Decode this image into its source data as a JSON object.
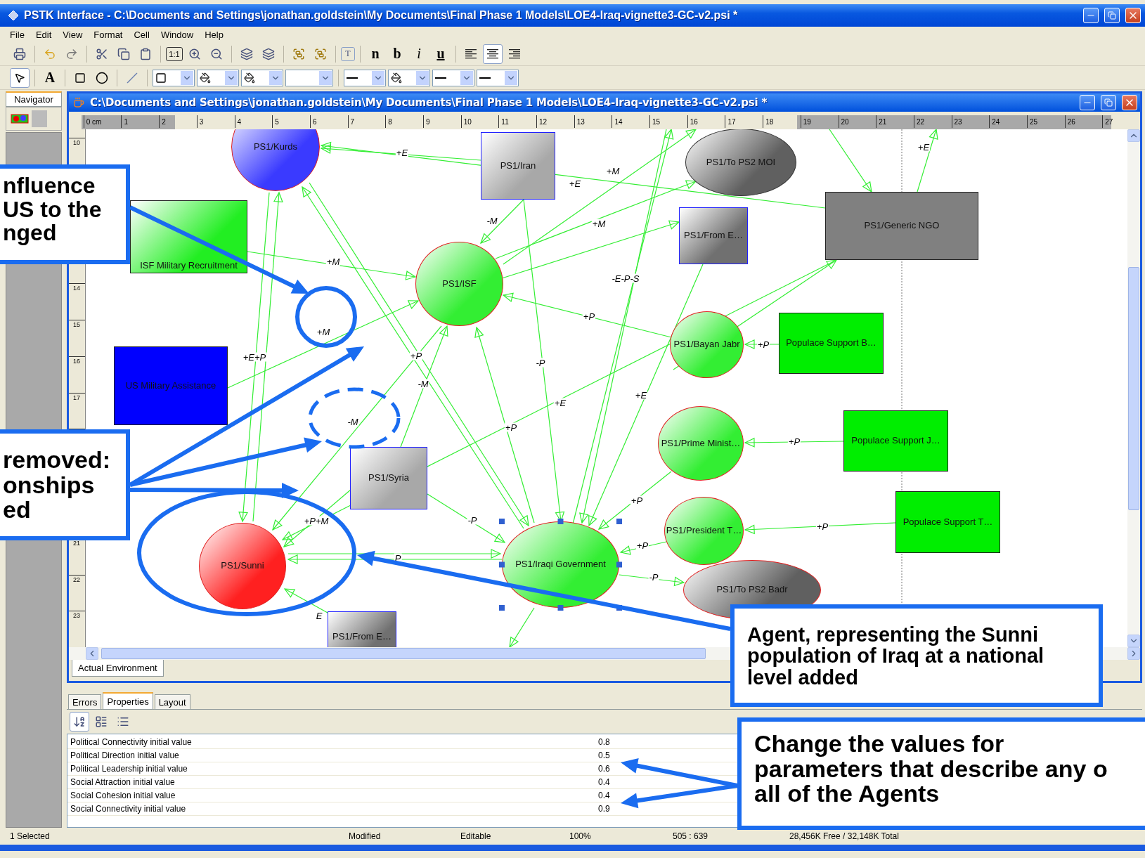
{
  "window": {
    "title": "PSTK Interface - C:\\Documents and Settings\\jonathan.goldstein\\My Documents\\Final Phase 1 Models\\LOE4-Iraq-vignette3-GC-v2.psi *"
  },
  "menu": [
    "File",
    "Edit",
    "View",
    "Format",
    "Cell",
    "Window",
    "Help"
  ],
  "toolbar": {
    "zoom_actual": "1:1",
    "text_box": "T",
    "styles": [
      {
        "label": "n",
        "kind": "normal"
      },
      {
        "label": "b",
        "kind": "bold"
      },
      {
        "label": "i",
        "kind": "italic"
      },
      {
        "label": "u",
        "kind": "underline"
      }
    ],
    "align": [
      {
        "kind": "left",
        "selected": false
      },
      {
        "kind": "center",
        "selected": true
      },
      {
        "kind": "right",
        "selected": false
      }
    ]
  },
  "drawing_tools": [
    {
      "kind": "pointer",
      "selected": true
    },
    {
      "kind": "text",
      "label": "A",
      "selected": false
    },
    {
      "kind": "rect",
      "selected": false
    },
    {
      "kind": "ellipse",
      "selected": false
    },
    {
      "kind": "line",
      "selected": false
    }
  ],
  "navigator": {
    "tab": "Navigator"
  },
  "document": {
    "title": "C:\\Documents and Settings\\jonathan.goldstein\\My Documents\\Final Phase 1 Models\\LOE4-Iraq-vignette3-GC-v2.psi *",
    "ruler_h": [
      "0 cm",
      "1",
      "2",
      "3",
      "4",
      "5",
      "6",
      "7",
      "8",
      "9",
      "10",
      "11",
      "12",
      "13",
      "14",
      "15",
      "16",
      "17",
      "18",
      "19",
      "20",
      "21",
      "22",
      "23",
      "24",
      "25",
      "26",
      "27"
    ],
    "ruler_v": [
      [
        "10"
      ],
      [
        "14",
        "15",
        "16",
        "17"
      ],
      [
        "21",
        "22",
        "23"
      ]
    ],
    "nodes": [
      {
        "label": "PS1/Kurds",
        "kind": "ellipse",
        "gradient": true,
        "color": "#3a3aff",
        "selected": false
      },
      {
        "label": "PS1/Iran",
        "kind": "rect",
        "gradient": true,
        "color": "#a8a8a8",
        "selected": false
      },
      {
        "label": "PS1/To PS2 MOI",
        "kind": "ellipse",
        "gradient": true,
        "color": "#606060",
        "selected": false
      },
      {
        "label": "ISF Military Recruitment",
        "kind": "rect",
        "gradient": true,
        "color": "#22ee22",
        "selected": false
      },
      {
        "label": "PS1/Generic NGO",
        "kind": "rect",
        "gradient": false,
        "color": "#808080",
        "selected": false
      },
      {
        "label": "PS1/From E…",
        "kind": "rect",
        "gradient": true,
        "color": "#707070",
        "selected": false
      },
      {
        "label": "PS1/ISF",
        "kind": "ellipse",
        "gradient": true,
        "color": "#33ee33",
        "selected": false
      },
      {
        "label": "PS1/Bayan Jabr",
        "kind": "ellipse",
        "gradient": true,
        "color": "#33ee33",
        "selected": false
      },
      {
        "label": "Populace Support B…",
        "kind": "rect",
        "gradient": false,
        "color": "#00ee00",
        "selected": false
      },
      {
        "label": "US Military Assistance",
        "kind": "rect",
        "gradient": false,
        "color": "#0000ff",
        "selected": false
      },
      {
        "label": "PS1/Prime Minist…",
        "kind": "ellipse",
        "gradient": true,
        "color": "#33ee33",
        "selected": false
      },
      {
        "label": "Populace Support J…",
        "kind": "rect",
        "gradient": false,
        "color": "#00ee00",
        "selected": false
      },
      {
        "label": "PS1/Syria",
        "kind": "rect",
        "gradient": true,
        "color": "#a8a8a8",
        "selected": false
      },
      {
        "label": "Populace Support T…",
        "kind": "rect",
        "gradient": false,
        "color": "#00ee00",
        "selected": false
      },
      {
        "label": "PS1/President T…",
        "kind": "ellipse",
        "gradient": true,
        "color": "#33ee33",
        "selected": false
      },
      {
        "label": "PS1/Sunni",
        "kind": "ellipse",
        "gradient": true,
        "color": "#ff2020",
        "selected": false
      },
      {
        "label": "PS1/Iraqi Government",
        "kind": "ellipse",
        "gradient": true,
        "color": "#33ee33",
        "selected": true
      },
      {
        "label": "PS1/To PS2 Badr",
        "kind": "ellipse",
        "gradient": true,
        "color": "#606060",
        "selected": false
      },
      {
        "label": "PS1/From E…",
        "kind": "rect",
        "gradient": true,
        "color": "#707070",
        "selected": false
      }
    ],
    "edges": [
      {
        "label": "+E"
      },
      {
        "label": "+E"
      },
      {
        "label": "+M"
      },
      {
        "label": "+M"
      },
      {
        "label": "-M"
      },
      {
        "label": "+M"
      },
      {
        "label": "+M"
      },
      {
        "label": "+P"
      },
      {
        "label": "+P"
      },
      {
        "label": "+P"
      },
      {
        "label": "+P"
      },
      {
        "label": "+P"
      },
      {
        "label": "+P"
      },
      {
        "label": "-P"
      },
      {
        "label": "+E+P"
      },
      {
        "label": "+P"
      },
      {
        "label": "-M"
      },
      {
        "label": "-M"
      },
      {
        "label": "+P+M"
      },
      {
        "label": "-P"
      },
      {
        "label": "P"
      },
      {
        "label": "E"
      },
      {
        "label": "+P"
      },
      {
        "label": "-P"
      },
      {
        "label": "-E-P-S"
      },
      {
        "label": "+E"
      },
      {
        "label": "+E"
      },
      {
        "label": "+E"
      }
    ],
    "tabs": [
      {
        "label": "Actual Environment",
        "selected": true
      }
    ]
  },
  "properties_panel": {
    "tabs": [
      {
        "label": "Errors",
        "selected": false
      },
      {
        "label": "Properties",
        "selected": true
      },
      {
        "label": "Layout",
        "selected": false
      }
    ],
    "rows": [
      {
        "name": "Political Connectivity initial value",
        "value": "0.8"
      },
      {
        "name": "Political Direction initial value",
        "value": "0.5"
      },
      {
        "name": "Political Leadership initial value",
        "value": "0.6"
      },
      {
        "name": "Social Attraction initial value",
        "value": "0.4"
      },
      {
        "name": "Social Cohesion initial value",
        "value": "0.4"
      },
      {
        "name": "Social Connectivity initial value",
        "value": "0.9"
      }
    ]
  },
  "status_bar": [
    "1 Selected",
    "Modified",
    "Editable",
    "100%",
    "505 : 639",
    "28,456K Free / 32,148K Total"
  ],
  "callouts": [
    {
      "lines": [
        "nfluence",
        "US to the",
        "nged"
      ]
    },
    {
      "lines": [
        "removed:",
        "onships",
        "ed"
      ]
    },
    {
      "lines": [
        "Agent, representing the Sunni",
        "population of Iraq at a national",
        "level added"
      ]
    },
    {
      "lines": [
        "Change the values for",
        "parameters that describe any o",
        "all of the Agents"
      ]
    }
  ]
}
